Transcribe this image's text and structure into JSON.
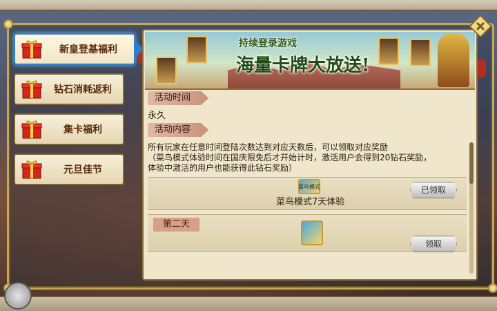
{
  "tabs": [
    {
      "label": "新皇登基福利",
      "active": true
    },
    {
      "label": "钻石消耗返利",
      "active": false
    },
    {
      "label": "集卡福利",
      "active": false
    },
    {
      "label": "元旦佳节",
      "active": false
    }
  ],
  "banner": {
    "subtitle": "持续登录游戏",
    "title": "海量卡牌大放送!"
  },
  "activity": {
    "time_label": "活动时间",
    "time_value": "永久",
    "content_label": "活动内容",
    "description_line1": "所有玩家在任意时间登陆次数达到对应天数后，可以领取对应奖励",
    "description_line2": "（菜鸟模式体验时间在国庆限免后才开始计时，激活用户会得到20钻石奖励，",
    "description_line3": "体验中激活的用户也能获得此钻石奖励）"
  },
  "rewards": [
    {
      "day": "",
      "item_caption": "菜鸟模式",
      "label": "菜鸟模式7天体验",
      "button": "已领取"
    },
    {
      "day": "第二天",
      "label": "",
      "button": "领取"
    }
  ],
  "icons": {
    "tab_icon": "gift-icon",
    "close": "close-icon",
    "joystick": "joystick-icon"
  },
  "colors": {
    "frame_gold": "#c7a654",
    "active_tab_border": "#2e7ec9",
    "tab_text": "#5b2a0e"
  }
}
